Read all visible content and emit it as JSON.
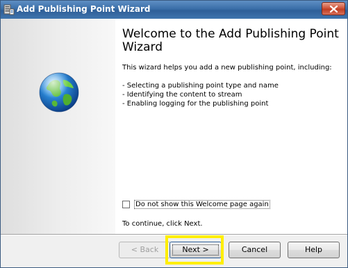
{
  "window": {
    "title": "Add Publishing Point Wizard"
  },
  "content": {
    "heading": "Welcome to the Add Publishing Point Wizard",
    "intro": "This wizard helps you add a new publishing point, including:",
    "bullets": [
      "- Selecting a publishing point type and name",
      "- Identifying the content to stream",
      "- Enabling logging for the publishing point"
    ],
    "checkbox_label": "Do not show this Welcome page again",
    "checkbox_checked": false,
    "continue_text": "To continue, click Next."
  },
  "footer": {
    "back_label": "< Back",
    "next_label": "Next >",
    "cancel_label": "Cancel",
    "help_label": "Help"
  },
  "colors": {
    "title_bar": "#3a6ea8",
    "highlight": "#ffee00",
    "close_button": "#c8452a"
  }
}
